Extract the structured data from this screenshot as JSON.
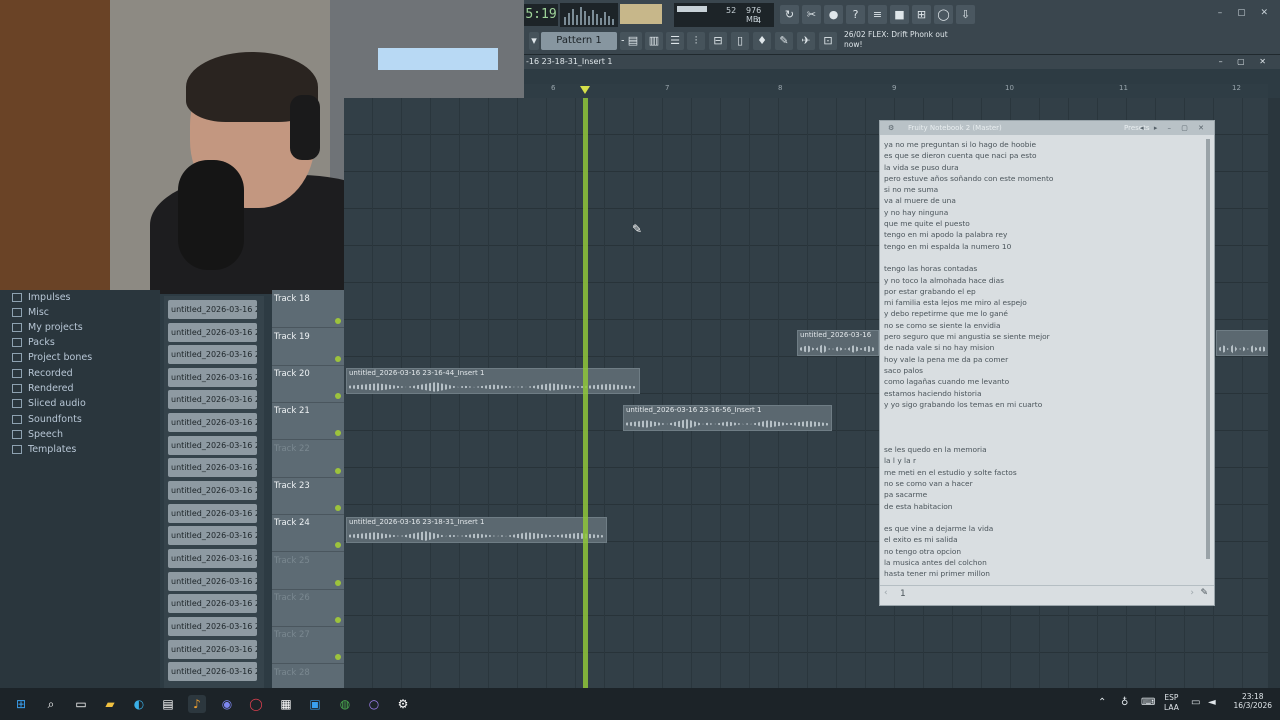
{
  "toolbar": {
    "time": "5:19",
    "cpu_text": "976 MB",
    "cpu_value": "52",
    "cpu_sub": "4",
    "pattern_label": "Pattern 1",
    "hint_text": "26/02  FLEX: Drift Phonk out now!"
  },
  "playlist": {
    "title": "-16 23-18-31_Insert 1",
    "ruler": [
      "6",
      "7",
      "8",
      "9",
      "10",
      "11",
      "12"
    ]
  },
  "browser": {
    "items": [
      "Impulses",
      "Misc",
      "My projects",
      "Packs",
      "Project bones",
      "Recorded",
      "Rendered",
      "Sliced audio",
      "Soundfonts",
      "Speech",
      "Templates"
    ]
  },
  "channels": {
    "label": "untitled_2026-03-16 22-...",
    "count": 17
  },
  "tracks": [
    {
      "name": "Track 18",
      "dim": false
    },
    {
      "name": "Track 19",
      "dim": false
    },
    {
      "name": "Track 20",
      "dim": false
    },
    {
      "name": "Track 21",
      "dim": false
    },
    {
      "name": "Track 22",
      "dim": true
    },
    {
      "name": "Track 23",
      "dim": false
    },
    {
      "name": "Track 24",
      "dim": false
    },
    {
      "name": "Track 25",
      "dim": true
    },
    {
      "name": "Track 26",
      "dim": true
    },
    {
      "name": "Track 27",
      "dim": true
    },
    {
      "name": "Track 28",
      "dim": true
    }
  ],
  "clips": {
    "c1": "untitled_2026-03-16 23-16-44_Insert 1",
    "c2": "untitled_2026-03-16 23-16-56_Insert 1",
    "c3": "untitled_2026-03-16 23-18-31_Insert 1",
    "c4": "untitled_2026-03-16"
  },
  "notebook": {
    "title": "Fruity Notebook 2 (Master)",
    "presets": "Presets",
    "page": "1",
    "lines": [
      "ya no me preguntan si lo hago de hoobie",
      "es que se dieron cuenta que naci pa esto",
      "la vida se puso dura",
      "pero estuve años soñando con este momento",
      "si no me suma",
      "va al muere de una",
      "y no hay ninguna",
      "que me quite el puesto",
      "tengo en mi apodo la palabra rey",
      "tengo en mi espalda la numero 10",
      "",
      "tengo las horas contadas",
      "y no toco la almohada hace dias",
      "por estar grabando el ep",
      "mi familia esta lejos me miro al espejo",
      "y debo repetirme que me lo gané",
      "no se como se siente la envidia",
      "pero seguro que mi angustia se siente mejor",
      "de nada vale si no hay mision",
      "hoy vale la pena me da pa comer",
      "saco palos",
      "como lagañas cuando me levanto",
      "estamos haciendo historia",
      "y yo sigo grabando los temas en mi cuarto",
      "",
      "",
      "",
      "se les quedo en la memoria",
      "la l y la r",
      "me meti en el estudio y solte factos",
      "no se como van a hacer",
      "pa sacarme",
      "de esta habitacion",
      "",
      "es que vine a dejarme la vida",
      "el exito es mi salida",
      "no tengo otra opcion",
      "la musica antes del colchon",
      "hasta tener mi primer millon"
    ]
  },
  "taskbar": {
    "lang1": "ESP",
    "lang2": "LAA",
    "time": "23:18",
    "date": "16/3/2026"
  }
}
